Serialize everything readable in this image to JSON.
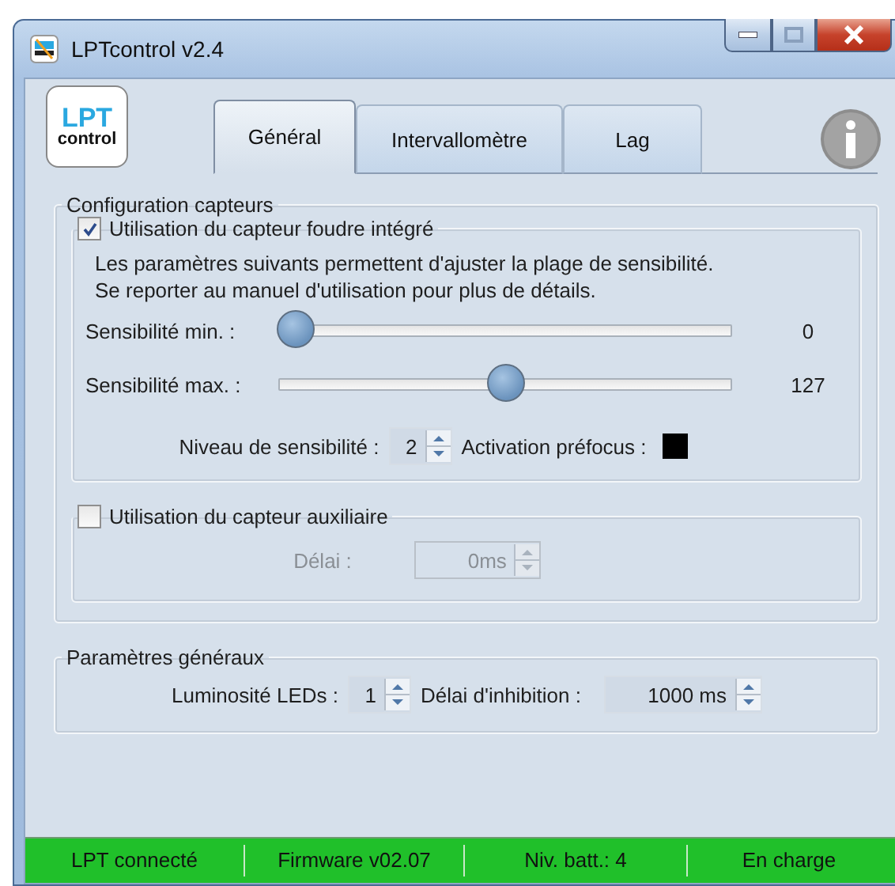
{
  "window": {
    "title": "LPTcontrol v2.4"
  },
  "logo": {
    "top": "LPT",
    "bottom": "control"
  },
  "tabs": [
    {
      "label": "Général",
      "selected": true
    },
    {
      "label": "Intervallomètre",
      "selected": false
    },
    {
      "label": "Lag",
      "selected": false
    }
  ],
  "sensors_group": {
    "title": "Configuration capteurs",
    "lightning": {
      "label": "Utilisation du capteur foudre intégré",
      "checked": true,
      "description": [
        "Les paramètres suivants permettent d'ajuster la plage de sensibilité.",
        "Se reporter au manuel d'utilisation pour plus de détails."
      ],
      "sliders": [
        {
          "label": "Sensibilité min. :",
          "level": 0,
          "reading": "0"
        },
        {
          "label": "Sensibilité max. :",
          "level": 0.5,
          "reading": "127"
        }
      ],
      "level_label": "Niveau de sensibilité :",
      "level_value": "2",
      "prefocus_label": "Activation préfocus :",
      "prefocus_on": true
    },
    "auxiliary": {
      "label": "Utilisation du capteur auxiliaire",
      "checked": false,
      "delay_label": "Délai :",
      "delay_value": "0ms",
      "disabled": true
    }
  },
  "general_group": {
    "title": "Paramètres généraux",
    "led_label": "Luminosité LEDs :",
    "led_value": "1",
    "inhibit_label": "Délai d'inhibition :",
    "inhibit_value": "1000 ms"
  },
  "status_bar": [
    "LPT connecté",
    "Firmware v02.07",
    "Niv. batt.: 4",
    "En charge"
  ]
}
